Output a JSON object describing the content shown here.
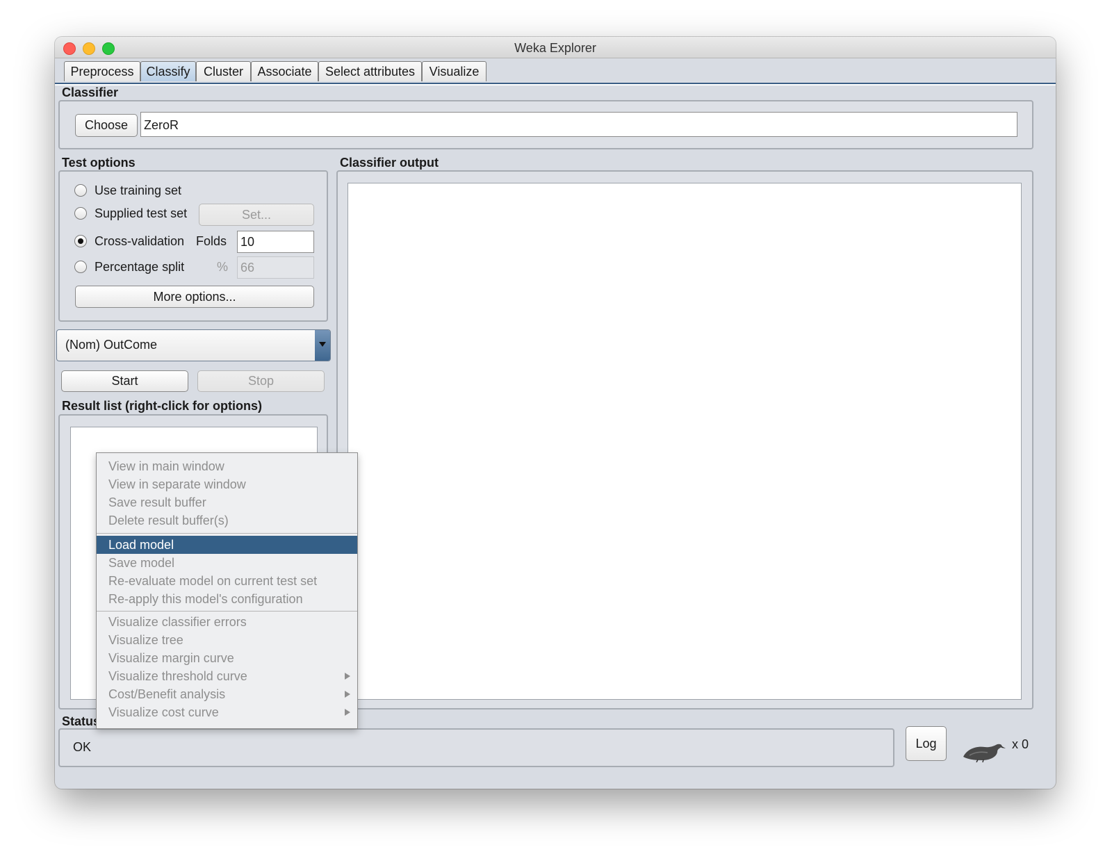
{
  "window": {
    "title": "Weka Explorer"
  },
  "tabs": [
    {
      "label": "Preprocess",
      "active": false
    },
    {
      "label": "Classify",
      "active": true
    },
    {
      "label": "Cluster",
      "active": false
    },
    {
      "label": "Associate",
      "active": false
    },
    {
      "label": "Select attributes",
      "active": false
    },
    {
      "label": "Visualize",
      "active": false
    }
  ],
  "classifier": {
    "section_title": "Classifier",
    "choose_label": "Choose",
    "value": "ZeroR"
  },
  "test_options": {
    "section_title": "Test options",
    "use_training_set": "Use training set",
    "supplied_test_set": "Supplied test set",
    "set_button": "Set...",
    "cross_validation": "Cross-validation",
    "folds_label": "Folds",
    "folds_value": "10",
    "percentage_split": "Percentage split",
    "percent_symbol": "%",
    "percent_value": "66",
    "more_options": "More options...",
    "selected": "cross_validation"
  },
  "class_attribute": {
    "value": "(Nom) OutCome"
  },
  "run": {
    "start": "Start",
    "stop": "Stop"
  },
  "result_list": {
    "section_title": "Result list (right-click for options)"
  },
  "output": {
    "section_title": "Classifier output"
  },
  "context_menu": {
    "items": [
      "View in main window",
      "View in separate window",
      "Save result buffer",
      "Delete result buffer(s)",
      "Load model",
      "Save model",
      "Re-evaluate model on current test set",
      "Re-apply this model's configuration",
      "Visualize classifier errors",
      "Visualize tree",
      "Visualize margin curve",
      "Visualize threshold curve",
      "Cost/Benefit analysis",
      "Visualize cost curve"
    ],
    "highlighted": "Load model"
  },
  "status": {
    "section_title": "Status",
    "text": "OK",
    "log_button": "Log",
    "count": "x 0"
  },
  "colors": {
    "selection": "#345f87",
    "tab_active": "#b9cfe6"
  }
}
